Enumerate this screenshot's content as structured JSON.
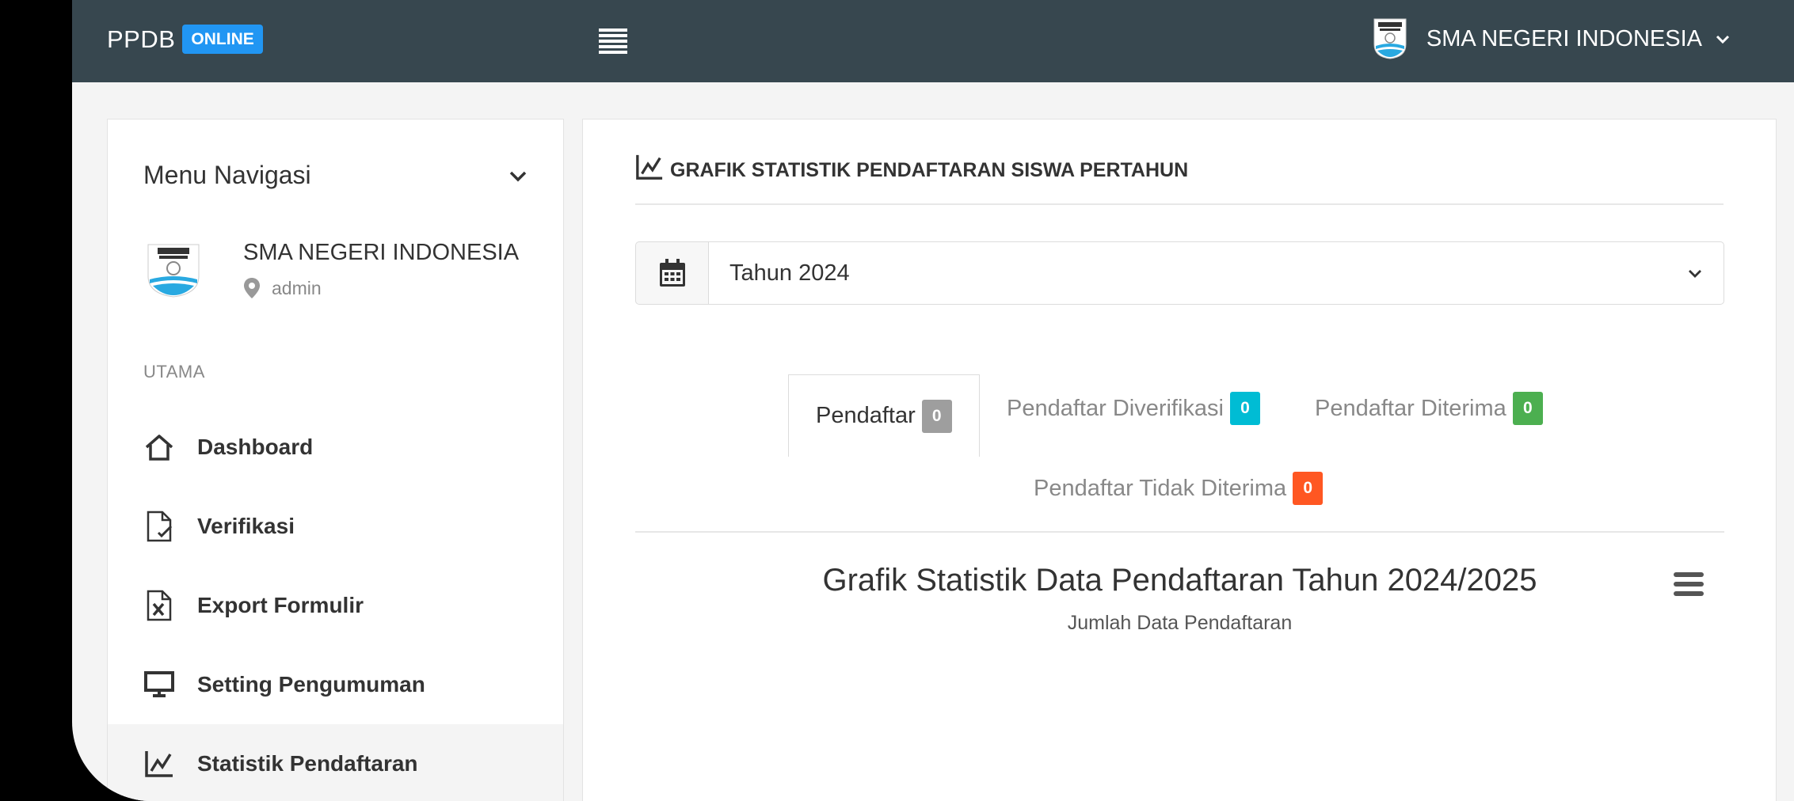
{
  "topbar": {
    "brand": "PPDB",
    "badge": "ONLINE",
    "menu_icon": "hamburger-icon",
    "school_name": "SMA NEGERI INDONESIA"
  },
  "sidebar": {
    "menu_title": "Menu Navigasi",
    "school_name": "SMA NEGERI INDONESIA",
    "role": "admin",
    "section": "UTAMA",
    "items": [
      {
        "label": "Dashboard",
        "icon": "home-icon"
      },
      {
        "label": "Verifikasi",
        "icon": "file-check-icon"
      },
      {
        "label": "Export Formulir",
        "icon": "excel-file-icon"
      },
      {
        "label": "Setting Pengumuman",
        "icon": "monitor-icon"
      },
      {
        "label": "Statistik Pendaftaran",
        "icon": "line-chart-icon",
        "active": true
      }
    ]
  },
  "main": {
    "panel_title": "GRAFIK STATISTIK PENDAFTARAN SISWA PERTAHUN",
    "year_select": "Tahun 2024",
    "tabs": [
      {
        "label": "Pendaftar",
        "count": "0",
        "color": "#9e9e9e",
        "active": true
      },
      {
        "label": "Pendaftar Diverifikasi",
        "count": "0",
        "color": "#00bcd4"
      },
      {
        "label": "Pendaftar Diterima",
        "count": "0",
        "color": "#4caf50"
      },
      {
        "label": "Pendaftar Tidak Diterima",
        "count": "0",
        "color": "#ff5722"
      }
    ],
    "chart": {
      "title": "Grafik Statistik Data Pendaftaran Tahun 2024/2025",
      "subtitle": "Jumlah Data Pendaftaran"
    }
  },
  "colors": {
    "topbar": "#37474f",
    "accent": "#2196f3"
  }
}
